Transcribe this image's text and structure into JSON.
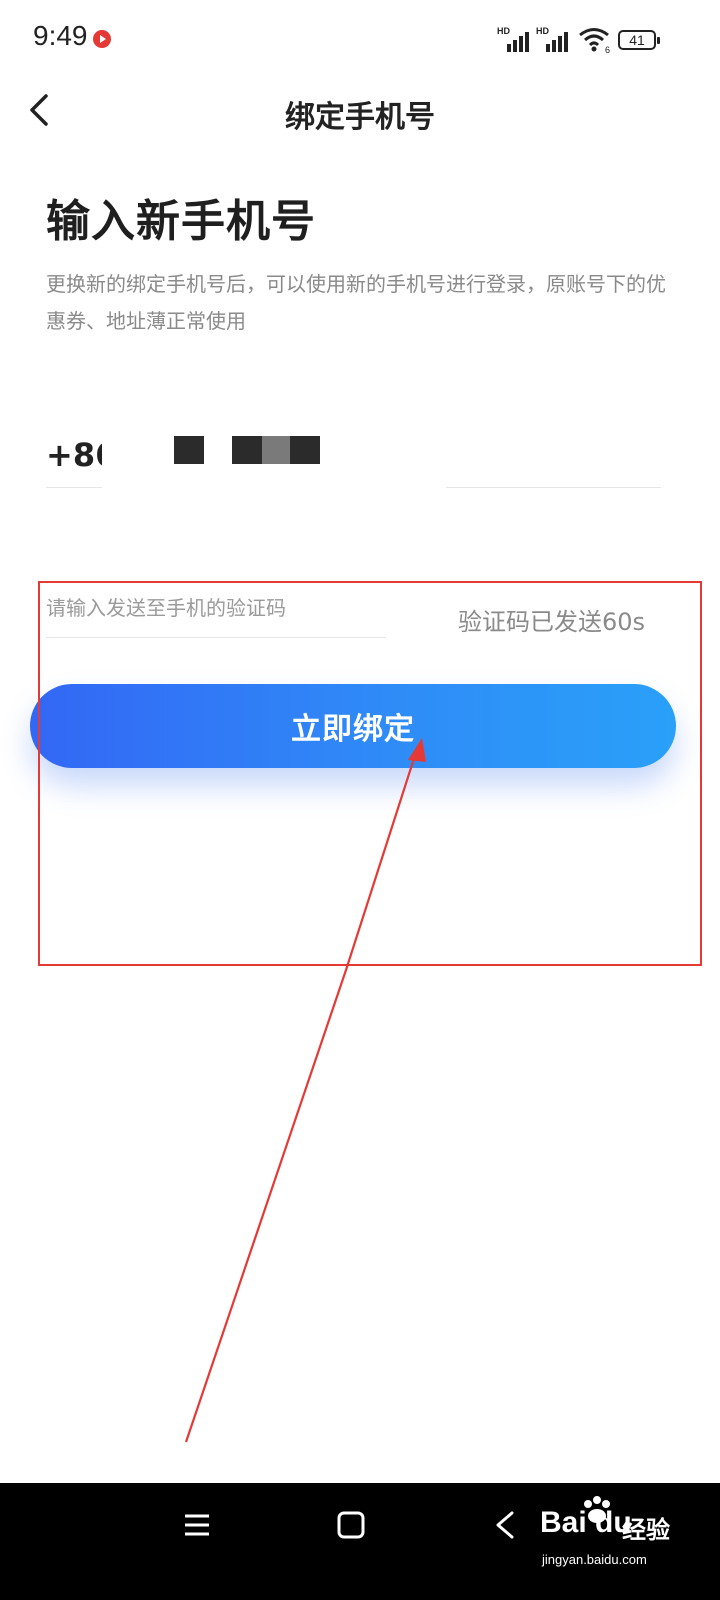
{
  "status_bar": {
    "time": "9:49",
    "battery": "41",
    "signal_label_1": "HD",
    "signal_label_2": "HD",
    "wifi_label": "6"
  },
  "header": {
    "title": "绑定手机号"
  },
  "main": {
    "headline": "输入新手机号",
    "description": "更换新的绑定手机号后，可以使用新的手机号进行登录，原账号下的优惠券、地址薄正常使用",
    "country_code": "+86",
    "code_placeholder": "请输入发送至手机的验证码",
    "countdown": "验证码已发送60s",
    "bind_button": "立即绑定"
  },
  "watermark": {
    "brand": "Bai du",
    "cn": "经验",
    "url": "jingyan.baidu.com"
  },
  "colors": {
    "button_start": "#3367f5",
    "button_end": "#2aa0f9",
    "annotation": "#e53935"
  }
}
